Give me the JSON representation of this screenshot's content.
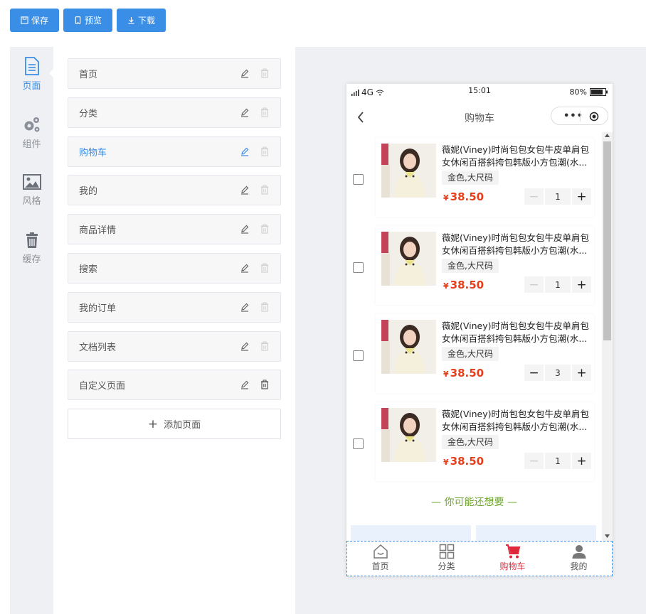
{
  "toolbar": {
    "save_label": "保存",
    "preview_label": "预览",
    "download_label": "下载",
    "color": "#3a8ee6"
  },
  "leftnav": {
    "items": [
      {
        "label": "页面",
        "icon": "document-icon",
        "active": true
      },
      {
        "label": "组件",
        "icon": "gears-icon",
        "active": false
      },
      {
        "label": "风格",
        "icon": "image-icon",
        "active": false
      },
      {
        "label": "缓存",
        "icon": "trash-icon",
        "active": false
      }
    ]
  },
  "pages": {
    "items": [
      {
        "label": "首页",
        "active": false,
        "deletable": false
      },
      {
        "label": "分类",
        "active": false,
        "deletable": false
      },
      {
        "label": "购物车",
        "active": true,
        "deletable": false
      },
      {
        "label": "我的",
        "active": false,
        "deletable": false
      },
      {
        "label": "商品详情",
        "active": false,
        "deletable": false
      },
      {
        "label": "搜索",
        "active": false,
        "deletable": false
      },
      {
        "label": "我的订单",
        "active": false,
        "deletable": false
      },
      {
        "label": "文档列表",
        "active": false,
        "deletable": false
      },
      {
        "label": "自定义页面",
        "active": false,
        "deletable": true
      }
    ],
    "add_label": "添加页面"
  },
  "phone": {
    "status": {
      "network": "4G",
      "time": "15:01",
      "battery": "80%"
    },
    "nav_title": "购物车",
    "cart_items": [
      {
        "name": "薇妮(Viney)时尚包包女包牛皮单肩包女休闲百搭斜挎包韩版小方包潮(水...",
        "sku": "金色,大尺码",
        "currency": "¥",
        "price": "38.50",
        "qty": "1",
        "can_decrease": false
      },
      {
        "name": "薇妮(Viney)时尚包包女包牛皮单肩包女休闲百搭斜挎包韩版小方包潮(水...",
        "sku": "金色,大尺码",
        "currency": "¥",
        "price": "38.50",
        "qty": "1",
        "can_decrease": false
      },
      {
        "name": "薇妮(Viney)时尚包包女包牛皮单肩包女休闲百搭斜挎包韩版小方包潮(水...",
        "sku": "金色,大尺码",
        "currency": "¥",
        "price": "38.50",
        "qty": "3",
        "can_decrease": true
      },
      {
        "name": "薇妮(Viney)时尚包包女包牛皮单肩包女休闲百搭斜挎包韩版小方包潮(水...",
        "sku": "金色,大尺码",
        "currency": "¥",
        "price": "38.50",
        "qty": "1",
        "can_decrease": false
      }
    ],
    "recommend_title": "— 你可能还想要 —",
    "price_color": "#e5401d",
    "recommend_color": "#6ea52e",
    "tabs": [
      {
        "label": "首页",
        "icon": "home-icon",
        "active": false
      },
      {
        "label": "分类",
        "icon": "grid-icon",
        "active": false
      },
      {
        "label": "购物车",
        "icon": "cart-icon",
        "active": true
      },
      {
        "label": "我的",
        "icon": "user-icon",
        "active": false
      }
    ],
    "active_tab_color": "#e0283c"
  }
}
